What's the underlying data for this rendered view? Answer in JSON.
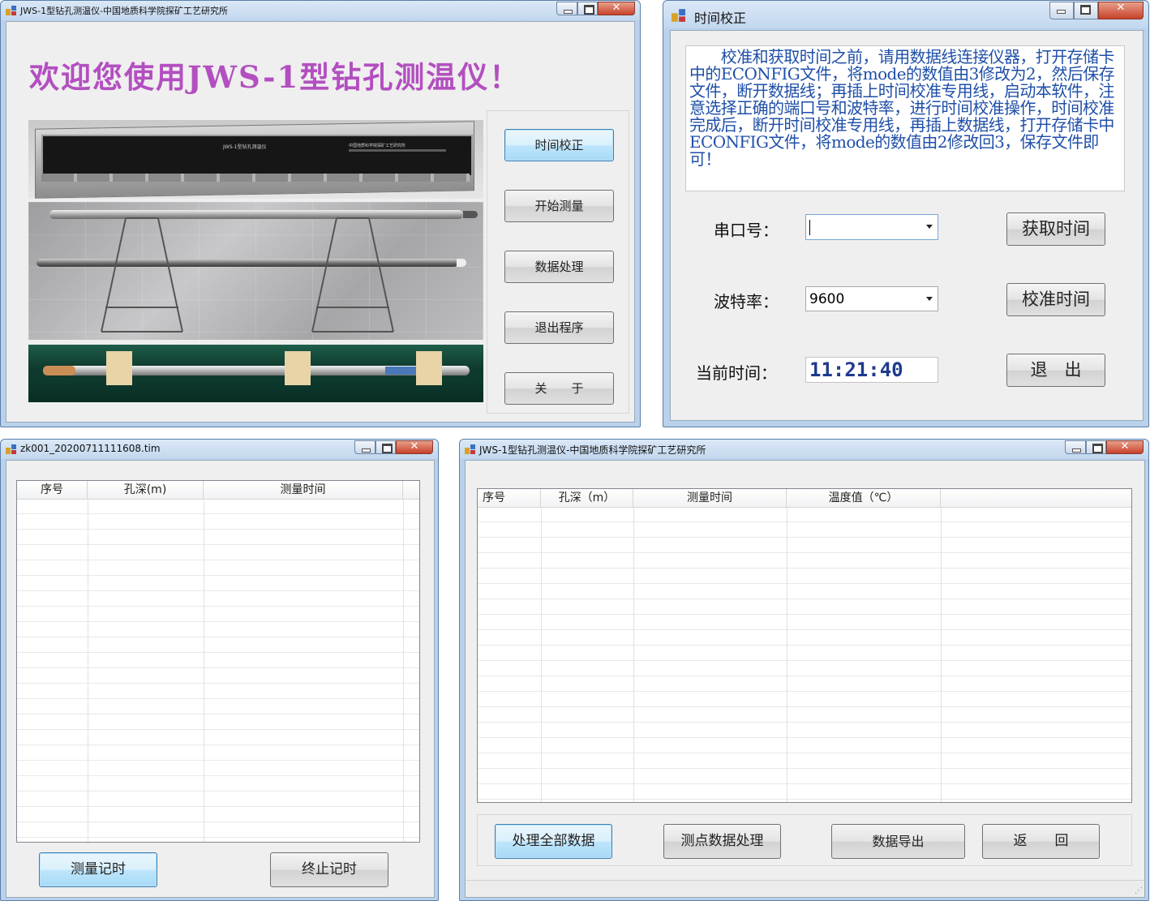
{
  "main_window": {
    "title": "JWS-1型钻孔测温仪-中国地质科学院探矿工艺研究所",
    "welcome": "欢迎您使用JWS-1型钻孔测温仪！",
    "case_label_left": "JWS-1型钻孔测温仪",
    "case_label_right": "中国地质科学院探矿工艺研究所 ",
    "buttons": [
      "时间校正",
      "开始测量",
      "数据处理",
      "退出程序",
      "关　　于"
    ]
  },
  "time_window": {
    "title": "时间校正",
    "instructions": "　　校准和获取时间之前，请用数据线连接仪器，打开存储卡中的ECONFIG文件，将mode的数值由3修改为2，然后保存文件，断开数据线；再插上时间校准专用线，启动本软件，注意选择正确的端口号和波特率，进行时间校准操作，时间校准完成后，断开时间校准专用线，再插上数据线，打开存储卡中ECONFIG文件，将mode的数值由2修改回3，保存文件即可！",
    "port_label": "串口号：",
    "port_value": "",
    "baud_label": "波特率：",
    "baud_value": "9600",
    "current_time_label": "当前时间：",
    "current_time_value": "11:21:40",
    "get_time_button": "获取时间",
    "calibrate_button": "校准时间",
    "exit_button": "退　出"
  },
  "record_window": {
    "title": "zk001_20200711111608.tim",
    "columns": [
      "序号",
      "孔深(m)",
      "测量时间"
    ],
    "start_button": "测量记时",
    "stop_button": "终止记时"
  },
  "process_window": {
    "title": "JWS-1型钻孔测温仪-中国地质科学院探矿工艺研究所",
    "columns": [
      "序号",
      "孔深（m）",
      "测量时间",
      "温度值（℃）"
    ],
    "buttons": [
      "处理全部数据",
      "测点数据处理",
      "数据导出",
      "返　　回"
    ]
  },
  "colors": {
    "welcome_text": "#b34fc0",
    "instruction_text": "#1f4fa8",
    "time_text": "#1f3a8f"
  }
}
